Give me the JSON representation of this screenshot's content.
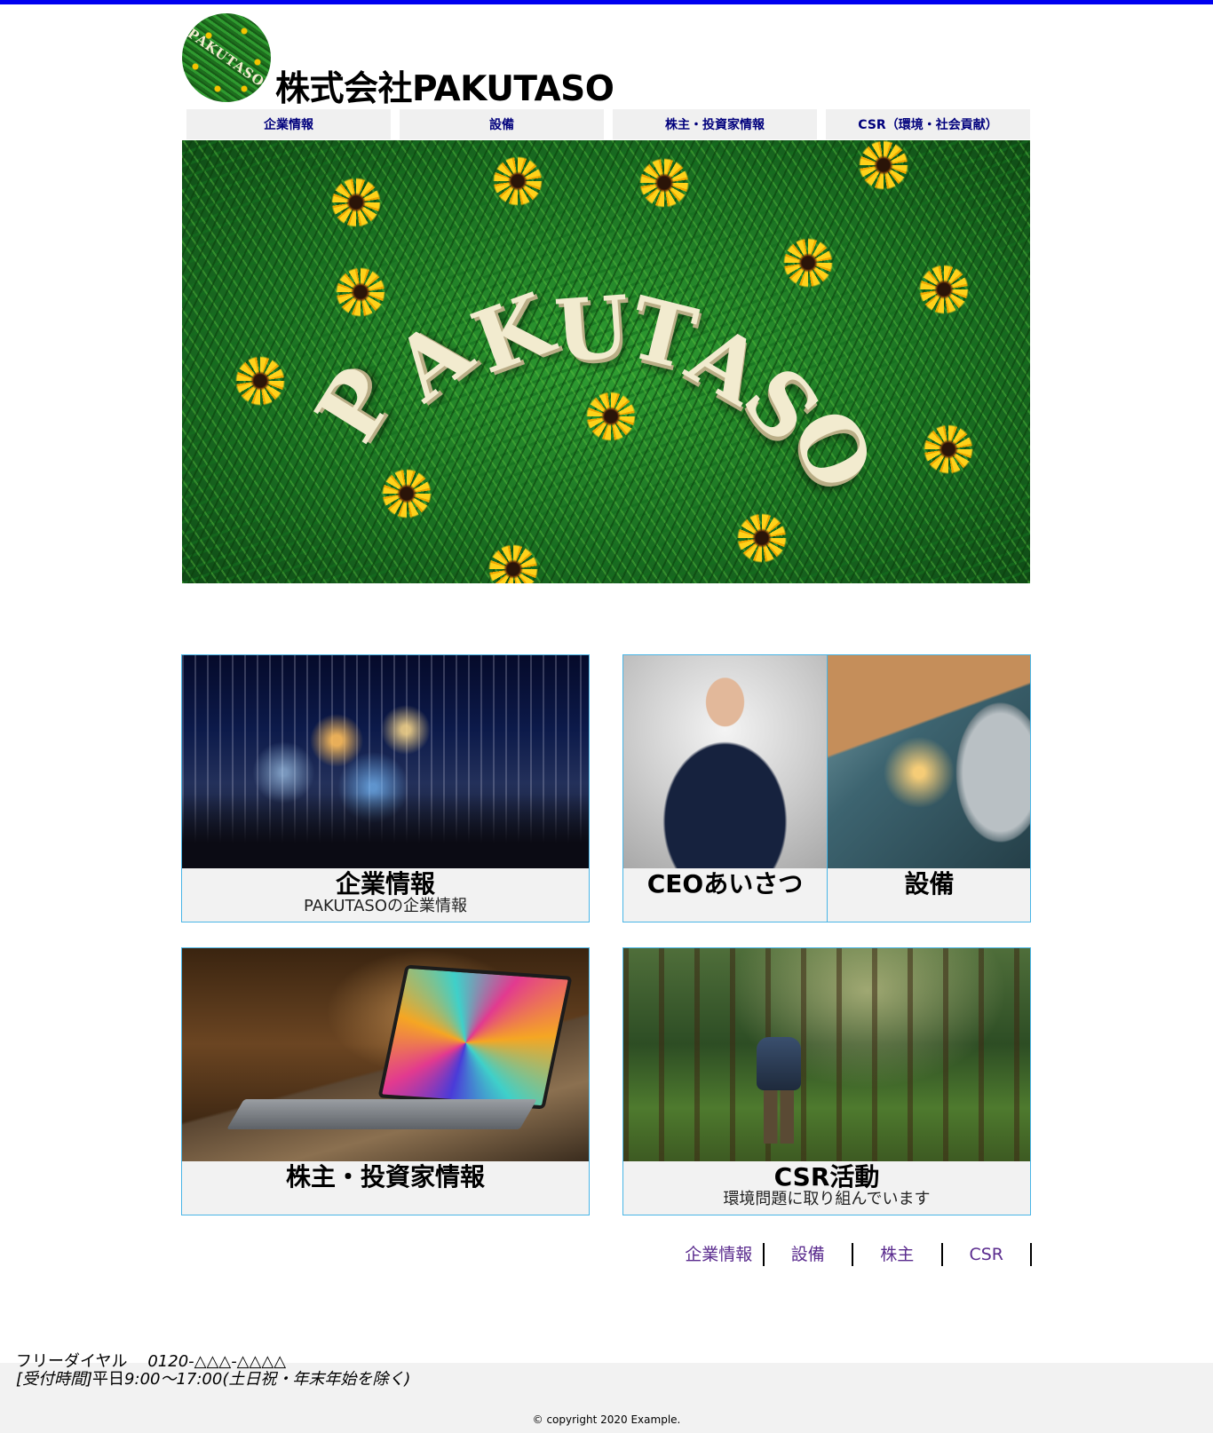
{
  "header": {
    "logo_text": "PAKUTASO",
    "company_name": "株式会社PAKUTASO"
  },
  "nav": {
    "items": [
      {
        "label": "企業情報"
      },
      {
        "label": "設備"
      },
      {
        "label": "株主・投資家情報"
      },
      {
        "label": "CSR（環境・社会貢献）"
      }
    ]
  },
  "hero": {
    "letters": [
      "P",
      "A",
      "K",
      "U",
      "T",
      "A",
      "S",
      "O"
    ]
  },
  "cards": {
    "company": {
      "title": "企業情報",
      "subtitle": "PAKUTASOの企業情報"
    },
    "ceo": {
      "title": "CEOあいさつ"
    },
    "equipment": {
      "title": "設備"
    },
    "investor": {
      "title": "株主・投資家情報"
    },
    "csr": {
      "title": "CSR活動",
      "subtitle": "環境問題に取り組んでいます"
    }
  },
  "footer_links": {
    "items": [
      {
        "label": "企業情報"
      },
      {
        "label": "設備"
      },
      {
        "label": "株主"
      },
      {
        "label": "CSR"
      }
    ]
  },
  "footer": {
    "free_dial_label": "フリーダイヤル",
    "free_dial_number": "0120-△△△-△△△△",
    "hours_label": "[受付時間]",
    "hours_days": "平日",
    "hours_time": "9:00～17:00",
    "hours_note": "(土日祝・年末年始を除く)",
    "copyright": "© copyright 2020 Example."
  },
  "colors": {
    "top_rule": "#0000f0",
    "nav_text": "#00007c",
    "card_border": "#49b5e6",
    "footer_link": "#5a2b8e"
  }
}
